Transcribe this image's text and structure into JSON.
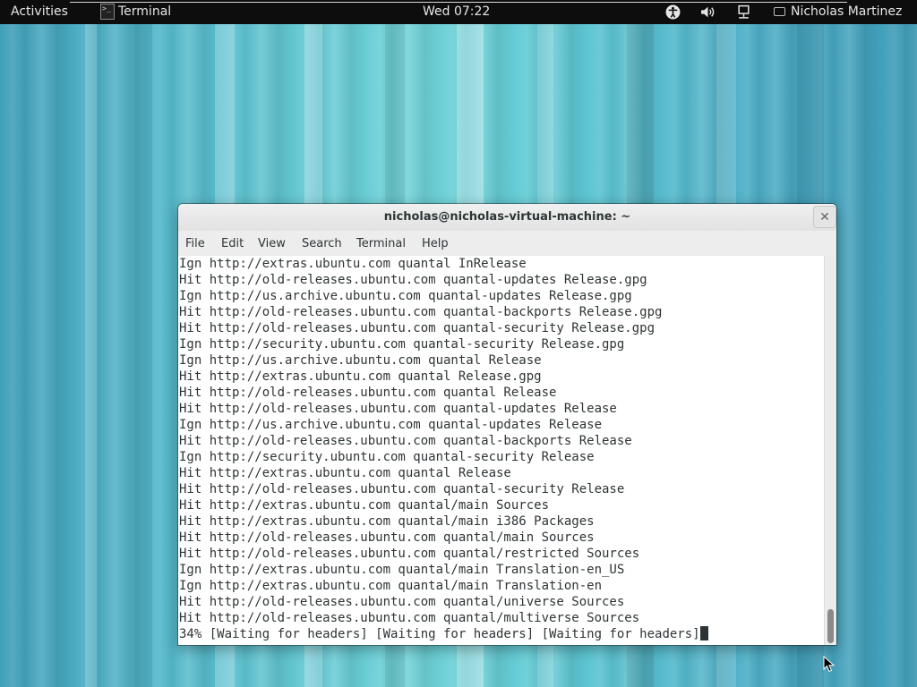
{
  "topbar": {
    "activities": "Activities",
    "app_name": "Terminal",
    "clock": "Wed 07:22",
    "user": "Nicholas Martinez",
    "icons": [
      "accessibility-icon",
      "volume-icon",
      "network-icon",
      "chat-icon"
    ]
  },
  "window": {
    "title": "nicholas@nicholas-virtual-machine: ~",
    "close_label": "✕",
    "menu": [
      "File",
      "Edit",
      "View",
      "Search",
      "Terminal",
      "Help"
    ]
  },
  "terminal": {
    "lines": [
      "Ign http://extras.ubuntu.com quantal InRelease",
      "Hit http://old-releases.ubuntu.com quantal-updates Release.gpg",
      "Ign http://us.archive.ubuntu.com quantal-updates Release.gpg",
      "Hit http://old-releases.ubuntu.com quantal-backports Release.gpg",
      "Hit http://old-releases.ubuntu.com quantal-security Release.gpg",
      "Ign http://security.ubuntu.com quantal-security Release.gpg",
      "Ign http://us.archive.ubuntu.com quantal Release",
      "Hit http://extras.ubuntu.com quantal Release.gpg",
      "Hit http://old-releases.ubuntu.com quantal Release",
      "Hit http://old-releases.ubuntu.com quantal-updates Release",
      "Ign http://us.archive.ubuntu.com quantal-updates Release",
      "Hit http://old-releases.ubuntu.com quantal-backports Release",
      "Ign http://security.ubuntu.com quantal-security Release",
      "Hit http://extras.ubuntu.com quantal Release",
      "Hit http://old-releases.ubuntu.com quantal-security Release",
      "Hit http://extras.ubuntu.com quantal/main Sources",
      "Hit http://extras.ubuntu.com quantal/main i386 Packages",
      "Hit http://old-releases.ubuntu.com quantal/main Sources",
      "Hit http://old-releases.ubuntu.com quantal/restricted Sources",
      "Ign http://extras.ubuntu.com quantal/main Translation-en_US",
      "Ign http://extras.ubuntu.com quantal/main Translation-en",
      "Hit http://old-releases.ubuntu.com quantal/universe Sources",
      "Hit http://old-releases.ubuntu.com quantal/multiverse Sources"
    ],
    "progress_line": "34% [Waiting for headers] [Waiting for headers] [Waiting for headers]"
  }
}
